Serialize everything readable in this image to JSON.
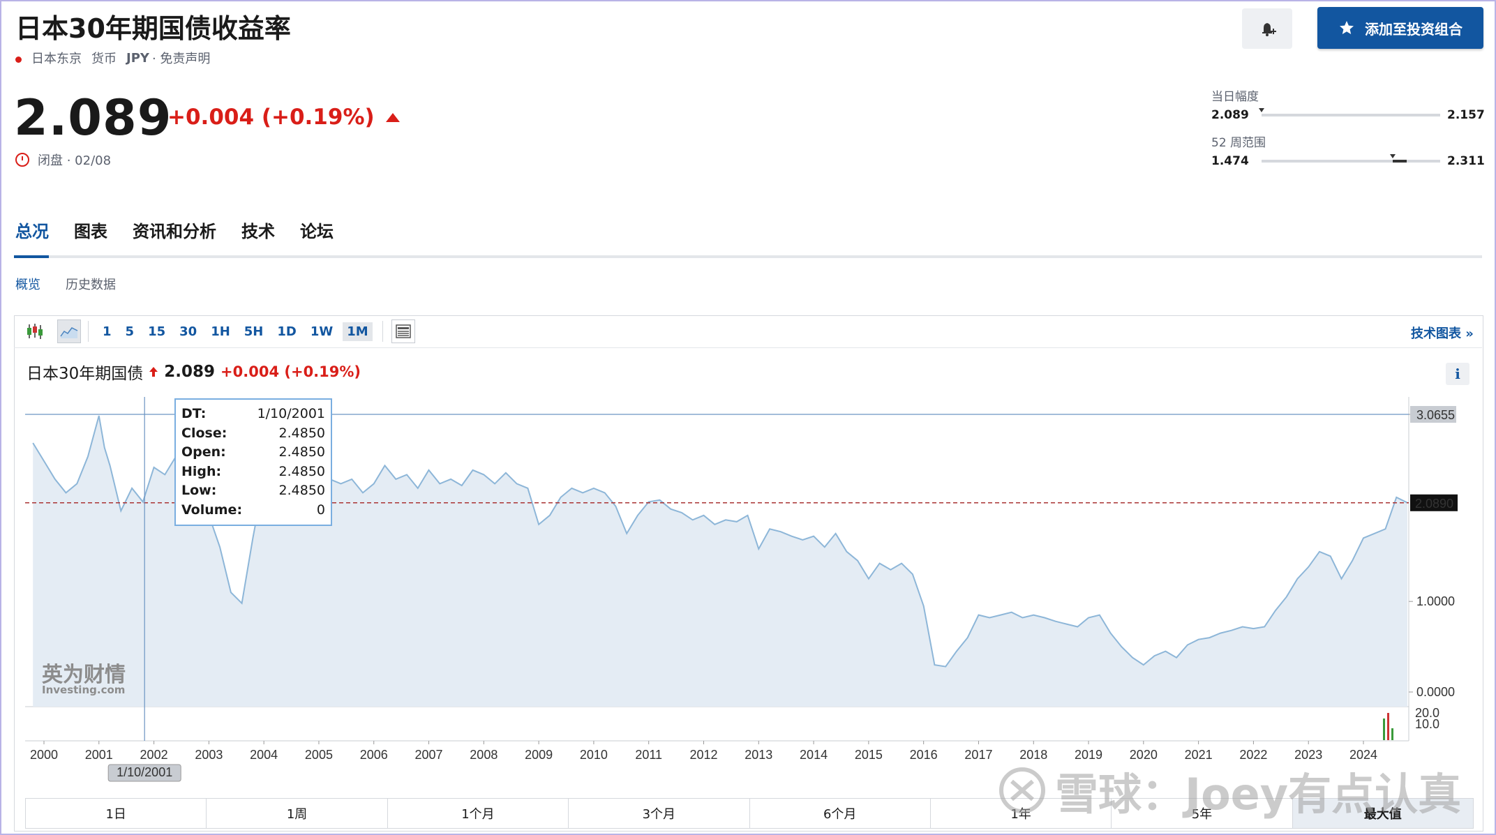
{
  "header": {
    "title": "日本30年期国债收益率",
    "location": "日本东京",
    "currency_label": "货币",
    "currency": "JPY",
    "disclaimer": "· 免责声明",
    "price": "2.089",
    "change": "+0.004 (+0.19%)",
    "status": "闭盘 · 02/08",
    "add_portfolio": "添加至投资组合",
    "colors": {
      "down_red": "#d91e18",
      "brand_blue": "#1256a0"
    }
  },
  "ranges": {
    "day_label": "当日幅度",
    "day_low": "2.089",
    "day_high": "2.157",
    "week52_label": "52 周范围",
    "week52_low": "1.474",
    "week52_high": "2.311",
    "day_marker_fraction": 0.0,
    "week52_marker_fraction": 0.735
  },
  "tabs": [
    "总况",
    "图表",
    "资讯和分析",
    "技术",
    "论坛"
  ],
  "subtabs": [
    "概览",
    "历史数据"
  ],
  "toolbar": {
    "intervals": [
      "1",
      "5",
      "15",
      "30",
      "1H",
      "5H",
      "1D",
      "1W",
      "1M"
    ],
    "active_interval": "1M",
    "tech_chart_link": "技术图表 »"
  },
  "chart_header": {
    "name": "日本30年期国债",
    "price": "2.089",
    "change": "+0.004 (+0.19%)"
  },
  "tooltip": {
    "rows": [
      {
        "k": "DT:",
        "v": "1/10/2001"
      },
      {
        "k": "Close:",
        "v": "2.4850"
      },
      {
        "k": "Open:",
        "v": "2.4850"
      },
      {
        "k": "High:",
        "v": "2.4850"
      },
      {
        "k": "Low:",
        "v": "2.4850"
      },
      {
        "k": "Volume:",
        "v": "0"
      }
    ],
    "cursor_date": "1/10/2001"
  },
  "periods": [
    "1日",
    "1周",
    "1个月",
    "3个月",
    "6个月",
    "1年",
    "5年",
    "最大值"
  ],
  "logo": {
    "cn": "英为财情",
    "en": "Investing.com"
  },
  "watermark": "雪球：Joey有点认真",
  "chart_data": {
    "type": "area",
    "x_ticks": [
      "2000",
      "2001",
      "2002",
      "2003",
      "2004",
      "2005",
      "2006",
      "2007",
      "2008",
      "2009",
      "2010",
      "2011",
      "2012",
      "2013",
      "2014",
      "2015",
      "2016",
      "2017",
      "2018",
      "2019",
      "2020",
      "2021",
      "2022",
      "2023",
      "2024"
    ],
    "y_ticks": [
      "0.0000",
      "1.0000",
      "3.0655"
    ],
    "volume_ticks": [
      "20.0",
      "10.0"
    ],
    "current_value_label": "2.0890",
    "max_value_label": "3.0655",
    "ylim": [
      0,
      3.0655
    ],
    "xlim": [
      1999.8,
      2025.1
    ],
    "x": [
      1999.8,
      2000.0,
      2000.2,
      2000.4,
      2000.6,
      2000.8,
      2001.0,
      2001.1,
      2001.2,
      2001.4,
      2001.6,
      2001.8,
      2002.0,
      2002.2,
      2002.4,
      2002.6,
      2002.8,
      2003.0,
      2003.2,
      2003.4,
      2003.6,
      2003.8,
      2004.0,
      2004.2,
      2004.4,
      2004.6,
      2004.8,
      2005.0,
      2005.2,
      2005.4,
      2005.6,
      2005.8,
      2006.0,
      2006.2,
      2006.4,
      2006.6,
      2006.8,
      2007.0,
      2007.2,
      2007.4,
      2007.6,
      2007.8,
      2008.0,
      2008.2,
      2008.4,
      2008.6,
      2008.8,
      2009.0,
      2009.2,
      2009.4,
      2009.6,
      2009.8,
      2010.0,
      2010.2,
      2010.4,
      2010.6,
      2010.8,
      2011.0,
      2011.2,
      2011.4,
      2011.6,
      2011.8,
      2012.0,
      2012.2,
      2012.4,
      2012.6,
      2012.8,
      2013.0,
      2013.2,
      2013.4,
      2013.6,
      2013.8,
      2014.0,
      2014.2,
      2014.4,
      2014.6,
      2014.8,
      2015.0,
      2015.2,
      2015.4,
      2015.6,
      2015.8,
      2016.0,
      2016.2,
      2016.4,
      2016.6,
      2016.8,
      2017.0,
      2017.2,
      2017.4,
      2017.6,
      2017.8,
      2018.0,
      2018.2,
      2018.4,
      2018.6,
      2018.8,
      2019.0,
      2019.2,
      2019.4,
      2019.6,
      2019.8,
      2020.0,
      2020.2,
      2020.4,
      2020.6,
      2020.8,
      2021.0,
      2021.2,
      2021.4,
      2021.6,
      2021.8,
      2022.0,
      2022.2,
      2022.4,
      2022.6,
      2022.8,
      2023.0,
      2023.2,
      2023.4,
      2023.6,
      2023.8,
      2024.0,
      2024.2,
      2024.4,
      2024.6,
      2024.8
    ],
    "values": [
      2.75,
      2.55,
      2.35,
      2.2,
      2.3,
      2.6,
      3.05,
      2.7,
      2.5,
      2.0,
      2.25,
      2.1,
      2.48,
      2.4,
      2.6,
      2.35,
      2.2,
      1.95,
      1.6,
      1.1,
      0.98,
      1.7,
      2.35,
      2.0,
      2.5,
      2.2,
      2.0,
      2.25,
      2.35,
      2.3,
      2.35,
      2.2,
      2.3,
      2.5,
      2.35,
      2.4,
      2.25,
      2.45,
      2.3,
      2.35,
      2.28,
      2.45,
      2.4,
      2.3,
      2.42,
      2.3,
      2.25,
      1.85,
      1.95,
      2.15,
      2.25,
      2.2,
      2.25,
      2.2,
      2.05,
      1.75,
      1.95,
      2.1,
      2.12,
      2.02,
      1.98,
      1.9,
      1.95,
      1.85,
      1.9,
      1.88,
      1.95,
      1.58,
      1.8,
      1.77,
      1.72,
      1.68,
      1.72,
      1.6,
      1.75,
      1.55,
      1.45,
      1.25,
      1.42,
      1.35,
      1.42,
      1.3,
      0.95,
      0.3,
      0.28,
      0.45,
      0.6,
      0.85,
      0.82,
      0.85,
      0.88,
      0.82,
      0.85,
      0.82,
      0.78,
      0.75,
      0.72,
      0.82,
      0.85,
      0.65,
      0.5,
      0.38,
      0.3,
      0.4,
      0.45,
      0.38,
      0.52,
      0.58,
      0.6,
      0.65,
      0.68,
      0.72,
      0.7,
      0.72,
      0.9,
      1.05,
      1.25,
      1.38,
      1.55,
      1.5,
      1.25,
      1.45,
      1.7,
      1.75,
      1.8,
      2.15,
      2.09
    ]
  }
}
